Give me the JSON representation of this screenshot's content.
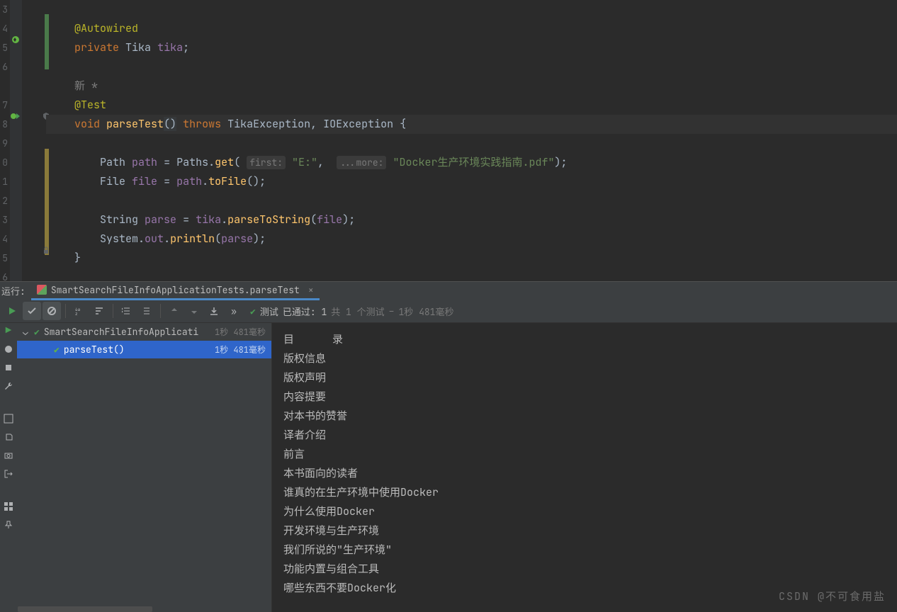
{
  "editor": {
    "line_numbers": [
      "3",
      "4",
      "5",
      "6",
      "",
      "7",
      "8",
      "9",
      "0",
      "1",
      "2",
      "3",
      "4",
      "5",
      "6"
    ],
    "code": {
      "l4": {
        "ann": "@Autowired"
      },
      "l5": {
        "kw": "private",
        "typ": "Tika",
        "var": "tika",
        "end": ";"
      },
      "l_new": {
        "cmt": "新 *"
      },
      "l7": {
        "ann": "@Test"
      },
      "l8": {
        "kw": "void",
        "mth": "parseTest",
        "par": "()",
        "throws": "throws",
        "ex1": "TikaException",
        "comma": ",",
        "ex2": "IOException",
        "brace": "{"
      },
      "l10": {
        "typ": "Path",
        "var": "path",
        "eq": "=",
        "cls": "Paths",
        "dot": ".",
        "mth": "get",
        "lp": "(",
        "hint1": "first:",
        "str1": "\"E:\"",
        "comma": ",",
        "hint2": "...more:",
        "str2": "\"Docker生产环境实践指南.pdf\"",
        "rp": ")",
        "end": ";"
      },
      "l11": {
        "typ": "File",
        "var": "file",
        "eq": "=",
        "ref": "path",
        "dot": ".",
        "mth": "toFile",
        "par": "()",
        "end": ";"
      },
      "l13": {
        "typ": "String",
        "var": "parse",
        "eq": "=",
        "ref": "tika",
        "dot": ".",
        "mth": "parseToString",
        "lp": "(",
        "arg": "file",
        "rp": ")",
        "end": ";"
      },
      "l14": {
        "cls": "System",
        "dot1": ".",
        "field": "out",
        "dot2": ".",
        "mth": "println",
        "lp": "(",
        "arg": "parse",
        "rp": ")",
        "end": ";"
      },
      "l15": {
        "brace": "}"
      }
    }
  },
  "run": {
    "label": "运行:",
    "tab_name": "SmartSearchFileInfoApplicationTests.parseTest",
    "close": "×"
  },
  "toolbar": {
    "status_prefix": "测试",
    "status_passed": "已通过: 1",
    "status_total": "共 1 个测试",
    "status_dash": " – ",
    "status_time": "1秒 481毫秒"
  },
  "tree": {
    "root": {
      "name": "SmartSearchFileInfoApplicati",
      "time": "1秒 481毫秒"
    },
    "child": {
      "name": "parseTest()",
      "time": "1秒 481毫秒"
    }
  },
  "console": {
    "lines": [
      "目      录",
      "",
      "版权信息",
      "版权声明",
      "内容提要",
      "对本书的赞誉",
      "译者介绍",
      "前言",
      "本书面向的读者",
      "谁真的在生产环境中使用Docker",
      "为什么使用Docker",
      "开发环境与生产环境",
      "我们所说的\"生产环境\"",
      "功能内置与组合工具",
      "哪些东西不要Docker化"
    ]
  },
  "watermark": "CSDN @不可食用盐"
}
